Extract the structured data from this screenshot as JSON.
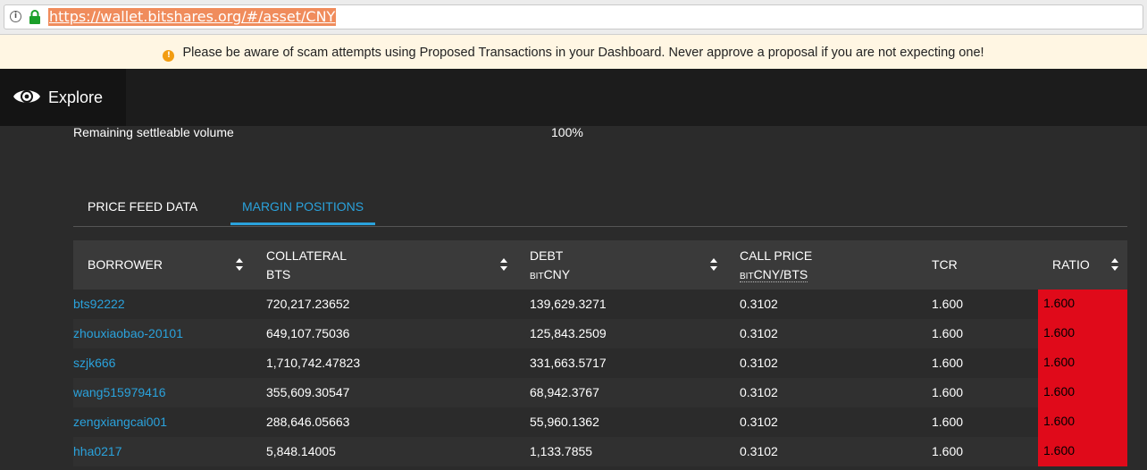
{
  "browser": {
    "url": "https://wallet.bitshares.org/#/asset/CNY"
  },
  "banner": {
    "icon": "warning-icon",
    "text": "Please be aware of scam attempts using Proposed Transactions in your Dashboard. Never approve a proposal if you are not expecting one!"
  },
  "nav": {
    "icon": "eye-icon",
    "label": "Explore"
  },
  "settle": {
    "label": "Remaining settleable volume",
    "value": "100%"
  },
  "tabs": [
    {
      "label": "PRICE FEED DATA"
    },
    {
      "label": "MARGIN POSITIONS"
    }
  ],
  "active_tab": "MARGIN POSITIONS",
  "table": {
    "headers": {
      "borrower": "BORROWER",
      "collateral": "COLLATERAL",
      "collateral_unit": "BTS",
      "debt": "DEBT",
      "debt_prefix": "bit",
      "debt_unit": "CNY",
      "call_price": "CALL PRICE",
      "call_prefix": "bit",
      "call_unit": "CNY/BTS",
      "tcr": "TCR",
      "ratio": "RATIO"
    },
    "rows": [
      {
        "borrower": "bts92222",
        "collateral": "720,217.23652",
        "debt": "139,629.3271",
        "call_price": "0.3102",
        "tcr": "1.600",
        "ratio": "1.600"
      },
      {
        "borrower": "zhouxiaobao-20101",
        "collateral": "649,107.75036",
        "debt": "125,843.2509",
        "call_price": "0.3102",
        "tcr": "1.600",
        "ratio": "1.600"
      },
      {
        "borrower": "szjk666",
        "collateral": "1,710,742.47823",
        "debt": "331,663.5717",
        "call_price": "0.3102",
        "tcr": "1.600",
        "ratio": "1.600"
      },
      {
        "borrower": "wang515979416",
        "collateral": "355,609.30547",
        "debt": "68,942.3767",
        "call_price": "0.3102",
        "tcr": "1.600",
        "ratio": "1.600"
      },
      {
        "borrower": "zengxiangcai001",
        "collateral": "288,646.05663",
        "debt": "55,960.1362",
        "call_price": "0.3102",
        "tcr": "1.600",
        "ratio": "1.600"
      },
      {
        "borrower": "hha0217",
        "collateral": "5,848.14005",
        "debt": "1,133.7855",
        "call_price": "0.3102",
        "tcr": "1.600",
        "ratio": "1.600"
      }
    ]
  },
  "colors": {
    "accent": "#2aa2dc",
    "danger": "#e00a1a",
    "warning": "#f29c11"
  }
}
